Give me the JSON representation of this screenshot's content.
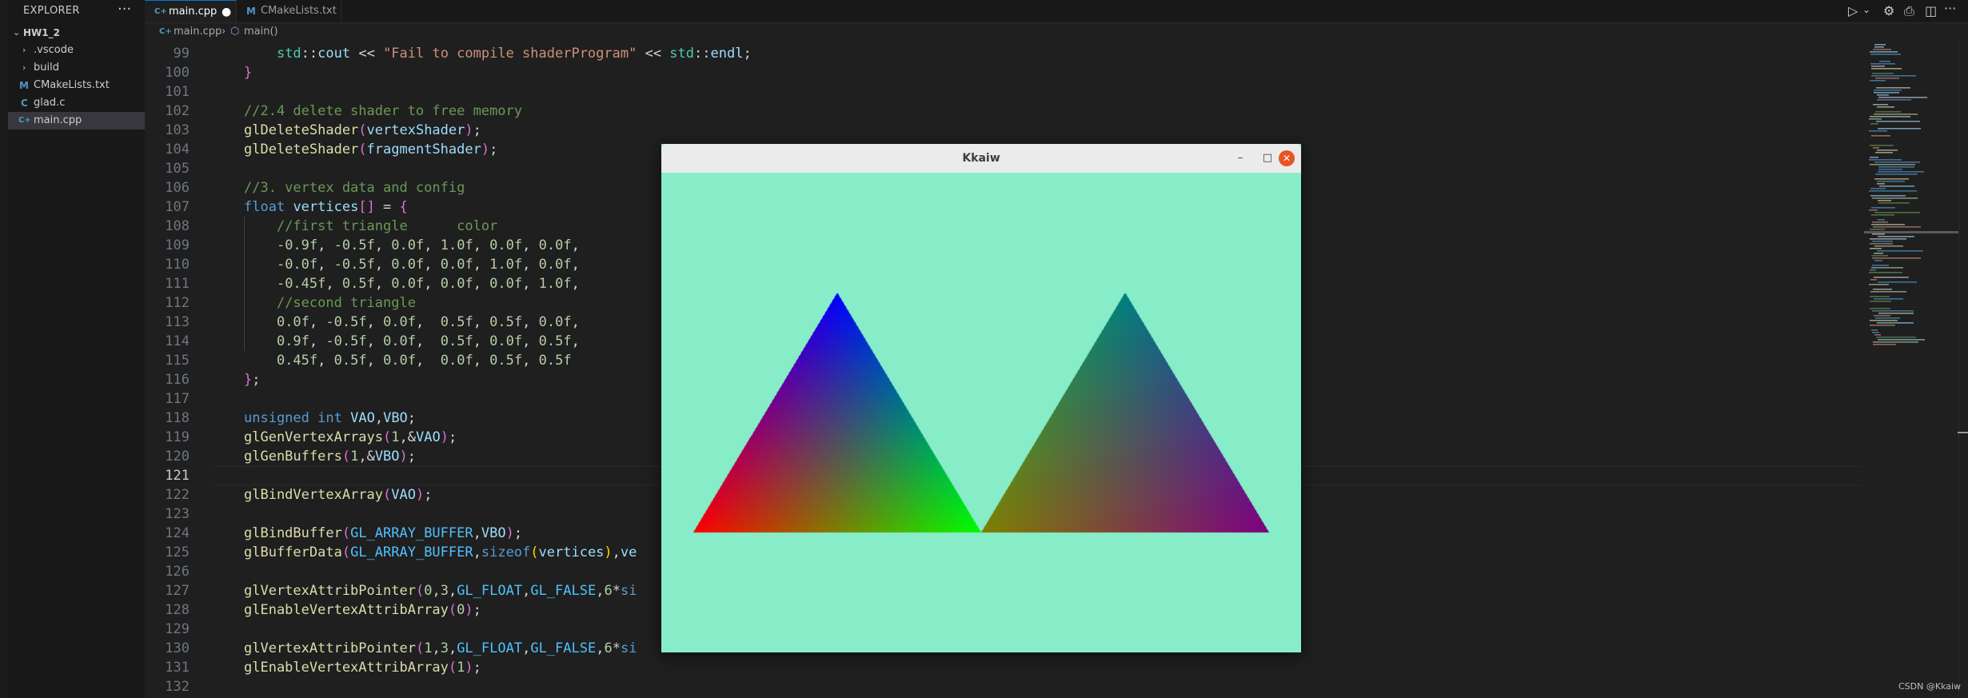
{
  "explorer": {
    "title": "EXPLORER",
    "more": "···",
    "project": "HW1_2",
    "items": [
      {
        "label": ".vscode",
        "type": "folder"
      },
      {
        "label": "build",
        "type": "folder"
      },
      {
        "label": "CMakeLists.txt",
        "type": "file",
        "icon_glyph": "M",
        "icon_color": "#4e94ce"
      },
      {
        "label": "glad.c",
        "type": "file",
        "icon_glyph": "C",
        "icon_color": "#519aba"
      },
      {
        "label": "main.cpp",
        "type": "file",
        "icon_glyph": "C+",
        "icon_color": "#519aba",
        "active": true
      }
    ]
  },
  "tabs": [
    {
      "label": "main.cpp",
      "icon_glyph": "C+",
      "icon_color": "#519aba",
      "active": true,
      "dirty": "●"
    },
    {
      "label": "CMakeLists.txt",
      "icon_glyph": "M",
      "icon_color": "#4e94ce",
      "active": false
    }
  ],
  "toolbar": {
    "run_icon": "▷",
    "run_dropdown": "⌄",
    "settings_icon": "⚙",
    "split_icon": "◫",
    "more_icon": "···"
  },
  "breadcrumb": {
    "file": "main.cpp",
    "separator": "›",
    "symbol": "main()"
  },
  "editor": {
    "current_line": 121,
    "lines": [
      {
        "n": "99",
        "html": "    <span class=\"ns\">std</span>::<span class=\"vr\">cout</span> &lt;&lt; <span class=\"st\">\"Fail to compile shaderProgram\"</span> &lt;&lt; <span class=\"ns\">std</span>::<span class=\"vr\">endl</span>;"
      },
      {
        "n": "100",
        "html": "<span class=\"pk\">}</span>"
      },
      {
        "n": "101",
        "html": ""
      },
      {
        "n": "102",
        "html": "<span class=\"cm\">//2.4 delete shader to free memory</span>"
      },
      {
        "n": "103",
        "html": "<span class=\"fn\">glDeleteShader</span><span class=\"pk\">(</span><span class=\"vr\">vertexShader</span><span class=\"pk\">)</span>;"
      },
      {
        "n": "104",
        "html": "<span class=\"fn\">glDeleteShader</span><span class=\"pk\">(</span><span class=\"vr\">fragmentShader</span><span class=\"pk\">)</span>;"
      },
      {
        "n": "105",
        "html": ""
      },
      {
        "n": "106",
        "html": "<span class=\"cm\">//3. vertex data and config</span>"
      },
      {
        "n": "107",
        "html": "<span class=\"kw\">float</span> <span class=\"vr\">vertices</span><span class=\"pk\">[]</span> = <span class=\"pk\">{</span>"
      },
      {
        "n": "108",
        "html": "    <span class=\"cm\">//first triangle      color</span>"
      },
      {
        "n": "109",
        "html": "    <span class=\"nm\">-0.9f</span>, <span class=\"nm\">-0.5f</span>, <span class=\"nm\">0.0f</span>, <span class=\"nm\">1.0f</span>, <span class=\"nm\">0.0f</span>, <span class=\"nm\">0.0f</span>,"
      },
      {
        "n": "110",
        "html": "    <span class=\"nm\">-0.0f</span>, <span class=\"nm\">-0.5f</span>, <span class=\"nm\">0.0f</span>, <span class=\"nm\">0.0f</span>, <span class=\"nm\">1.0f</span>, <span class=\"nm\">0.0f</span>,"
      },
      {
        "n": "111",
        "html": "    <span class=\"nm\">-0.45f</span>, <span class=\"nm\">0.5f</span>, <span class=\"nm\">0.0f</span>, <span class=\"nm\">0.0f</span>, <span class=\"nm\">0.0f</span>, <span class=\"nm\">1.0f</span>,"
      },
      {
        "n": "112",
        "html": "    <span class=\"cm\">//second triangle</span>"
      },
      {
        "n": "113",
        "html": "    <span class=\"nm\">0.0f</span>, <span class=\"nm\">-0.5f</span>, <span class=\"nm\">0.0f</span>,  <span class=\"nm\">0.5f</span>, <span class=\"nm\">0.5f</span>, <span class=\"nm\">0.0f</span>,"
      },
      {
        "n": "114",
        "html": "    <span class=\"nm\">0.9f</span>, <span class=\"nm\">-0.5f</span>, <span class=\"nm\">0.0f</span>,  <span class=\"nm\">0.5f</span>, <span class=\"nm\">0.0f</span>, <span class=\"nm\">0.5f</span>,"
      },
      {
        "n": "115",
        "html": "    <span class=\"nm\">0.45f</span>, <span class=\"nm\">0.5f</span>, <span class=\"nm\">0.0f</span>,  <span class=\"nm\">0.0f</span>, <span class=\"nm\">0.5f</span>, <span class=\"nm\">0.5f</span>"
      },
      {
        "n": "116",
        "html": "<span class=\"pk\">}</span>;"
      },
      {
        "n": "117",
        "html": ""
      },
      {
        "n": "118",
        "html": "<span class=\"kw\">unsigned</span> <span class=\"kw\">int</span> <span class=\"vr\">VAO</span>,<span class=\"vr\">VBO</span>;"
      },
      {
        "n": "119",
        "html": "<span class=\"fn\">glGenVertexArrays</span><span class=\"pk\">(</span><span class=\"nm\">1</span>,&amp;<span class=\"vr\">VAO</span><span class=\"pk\">)</span>;"
      },
      {
        "n": "120",
        "html": "<span class=\"fn\">glGenBuffers</span><span class=\"pk\">(</span><span class=\"nm\">1</span>,&amp;<span class=\"vr\">VBO</span><span class=\"pk\">)</span>;"
      },
      {
        "n": "121",
        "html": ""
      },
      {
        "n": "122",
        "html": "<span class=\"fn\">glBindVertexArray</span><span class=\"pk\">(</span><span class=\"vr\">VAO</span><span class=\"pk\">)</span>;"
      },
      {
        "n": "123",
        "html": ""
      },
      {
        "n": "124",
        "html": "<span class=\"fn\">glBindBuffer</span><span class=\"pk\">(</span><span class=\"mc\">GL_ARRAY_BUFFER</span>,<span class=\"vr\">VBO</span><span class=\"pk\">)</span>;"
      },
      {
        "n": "125",
        "html": "<span class=\"fn\">glBufferData</span><span class=\"pk\">(</span><span class=\"mc\">GL_ARRAY_BUFFER</span>,<span class=\"kw\">sizeof</span><span class=\"br\">(</span><span class=\"vr\">vertices</span><span class=\"br\">)</span>,<span class=\"vr\">ve</span>"
      },
      {
        "n": "126",
        "html": ""
      },
      {
        "n": "127",
        "html": "<span class=\"fn\">glVertexAttribPointer</span><span class=\"pk\">(</span><span class=\"nm\">0</span>,<span class=\"nm\">3</span>,<span class=\"mc\">GL_FLOAT</span>,<span class=\"mc\">GL_FALSE</span>,<span class=\"nm\">6</span>*<span class=\"kw\">si</span>"
      },
      {
        "n": "128",
        "html": "<span class=\"fn\">glEnableVertexAttribArray</span><span class=\"pk\">(</span><span class=\"nm\">0</span><span class=\"pk\">)</span>;"
      },
      {
        "n": "129",
        "html": ""
      },
      {
        "n": "130",
        "html": "<span class=\"fn\">glVertexAttribPointer</span><span class=\"pk\">(</span><span class=\"nm\">1</span>,<span class=\"nm\">3</span>,<span class=\"mc\">GL_FLOAT</span>,<span class=\"mc\">GL_FALSE</span>,<span class=\"nm\">6</span>*<span class=\"kw\">si</span>"
      },
      {
        "n": "131",
        "html": "<span class=\"fn\">glEnableVertexAttribArray</span><span class=\"pk\">(</span><span class=\"nm\">1</span><span class=\"pk\">)</span>;"
      },
      {
        "n": "132",
        "html": ""
      }
    ]
  },
  "gl_window": {
    "title": "Kkaiw",
    "minimize": "–",
    "maximize": "□",
    "close": "✕",
    "background": "#87edc8",
    "vertices": [
      [
        -0.9,
        -0.5,
        1.0,
        0.0,
        0.0
      ],
      [
        -0.0,
        -0.5,
        0.0,
        1.0,
        0.0
      ],
      [
        -0.45,
        0.5,
        0.0,
        0.0,
        1.0
      ],
      [
        0.0,
        -0.5,
        0.5,
        0.5,
        0.0
      ],
      [
        0.9,
        -0.5,
        0.5,
        0.0,
        0.5
      ],
      [
        0.45,
        0.5,
        0.0,
        0.5,
        0.5
      ]
    ]
  },
  "watermark": "CSDN @Kkaiw"
}
